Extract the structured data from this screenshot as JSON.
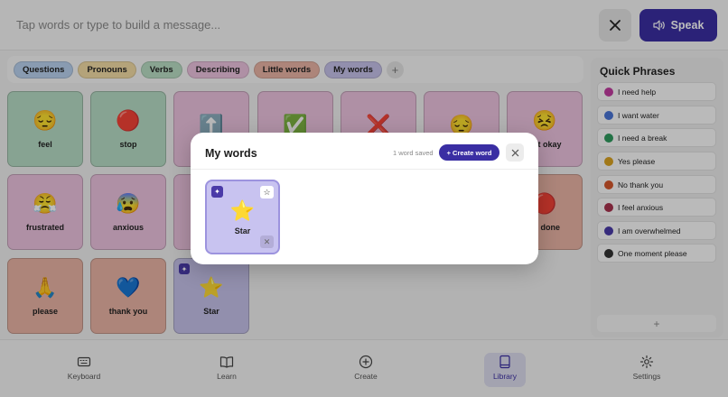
{
  "topbar": {
    "placeholder": "Tap words or type to build a message...",
    "speak_label": "Speak"
  },
  "categories": [
    {
      "label": "Questions",
      "bg": "#b9d2ef"
    },
    {
      "label": "Pronouns",
      "bg": "#f3dca5"
    },
    {
      "label": "Verbs",
      "bg": "#b9dec4"
    },
    {
      "label": "Describing",
      "bg": "#ecc3df"
    },
    {
      "label": "Little words",
      "bg": "#eab4a5"
    },
    {
      "label": "My words",
      "bg": "#c6c2ea"
    }
  ],
  "tiles": [
    {
      "label": "feel",
      "emoji": "😔"
    },
    {
      "label": "stop",
      "emoji": "🔴"
    },
    {
      "label": "",
      "emoji": "⬆️"
    },
    {
      "label": "",
      "emoji": "✅"
    },
    {
      "label": "",
      "emoji": "❌"
    },
    {
      "label": "",
      "emoji": "😔"
    },
    {
      "label": "not okay",
      "emoji": "😣"
    },
    {
      "label": "frustrated",
      "emoji": "😤"
    },
    {
      "label": "anxious",
      "emoji": "😰"
    },
    {
      "label": "all done",
      "emoji": "🔴"
    },
    {
      "label": "please",
      "emoji": "🙏"
    },
    {
      "label": "thank you",
      "emoji": "💙"
    },
    {
      "label": "Star",
      "emoji": "⭐"
    }
  ],
  "quick_phrases": {
    "title": "Quick Phrases",
    "items": [
      {
        "label": "I need help",
        "color": "#c13ca0"
      },
      {
        "label": "I want water",
        "color": "#4a74d6"
      },
      {
        "label": "I need a break",
        "color": "#2f9a5e"
      },
      {
        "label": "Yes please",
        "color": "#d9a321"
      },
      {
        "label": "No thank you",
        "color": "#d4572c"
      },
      {
        "label": "I feel anxious",
        "color": "#a8324e"
      },
      {
        "label": "I am overwhelmed",
        "color": "#4a3aa8"
      },
      {
        "label": "One moment please",
        "color": "#333333"
      }
    ],
    "add_label": "+"
  },
  "nav": [
    {
      "label": "Keyboard",
      "icon": "keyboard-icon"
    },
    {
      "label": "Learn",
      "icon": "book-icon"
    },
    {
      "label": "Create",
      "icon": "plus-circle-icon"
    },
    {
      "label": "Library",
      "icon": "library-icon",
      "active": true
    },
    {
      "label": "Settings",
      "icon": "gear-icon"
    }
  ],
  "modal": {
    "title": "My words",
    "count_text": "1 word saved",
    "create_label": "+ Create word",
    "word": {
      "label": "Star",
      "emoji": "⭐",
      "badge": "✦"
    }
  },
  "colors": {
    "accent": "#3a2ea3",
    "green": "#b7dcc5",
    "pink": "#ecc3df",
    "red": "#eab4a5",
    "purple": "#c6c2ea"
  }
}
